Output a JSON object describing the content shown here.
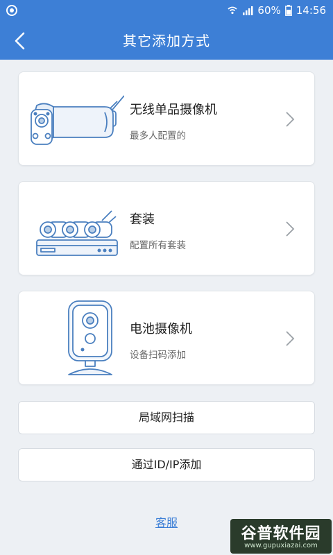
{
  "status_bar": {
    "battery": "60%",
    "time": "14:56"
  },
  "header": {
    "title": "其它添加方式"
  },
  "options": [
    {
      "name": "无线单品摄像机",
      "desc": "最多人配置的",
      "illustration": "wireless-bullet-camera"
    },
    {
      "name": "套装",
      "desc": "配置所有套装",
      "illustration": "nvr-kit"
    },
    {
      "name": "电池摄像机",
      "desc": "设备扫码添加",
      "illustration": "battery-camera"
    }
  ],
  "buttons": {
    "lan_scan": "局域网扫描",
    "add_by_id_ip": "通过ID/IP添加"
  },
  "footer": {
    "customer_service": "客服"
  },
  "watermark": {
    "title": "谷普软件园",
    "url": "www.gupuxiazai.com"
  },
  "colors": {
    "primary": "#3d7fd6",
    "background": "#edf0f4",
    "card": "#ffffff",
    "illustration_stroke": "#4a7fbf"
  }
}
